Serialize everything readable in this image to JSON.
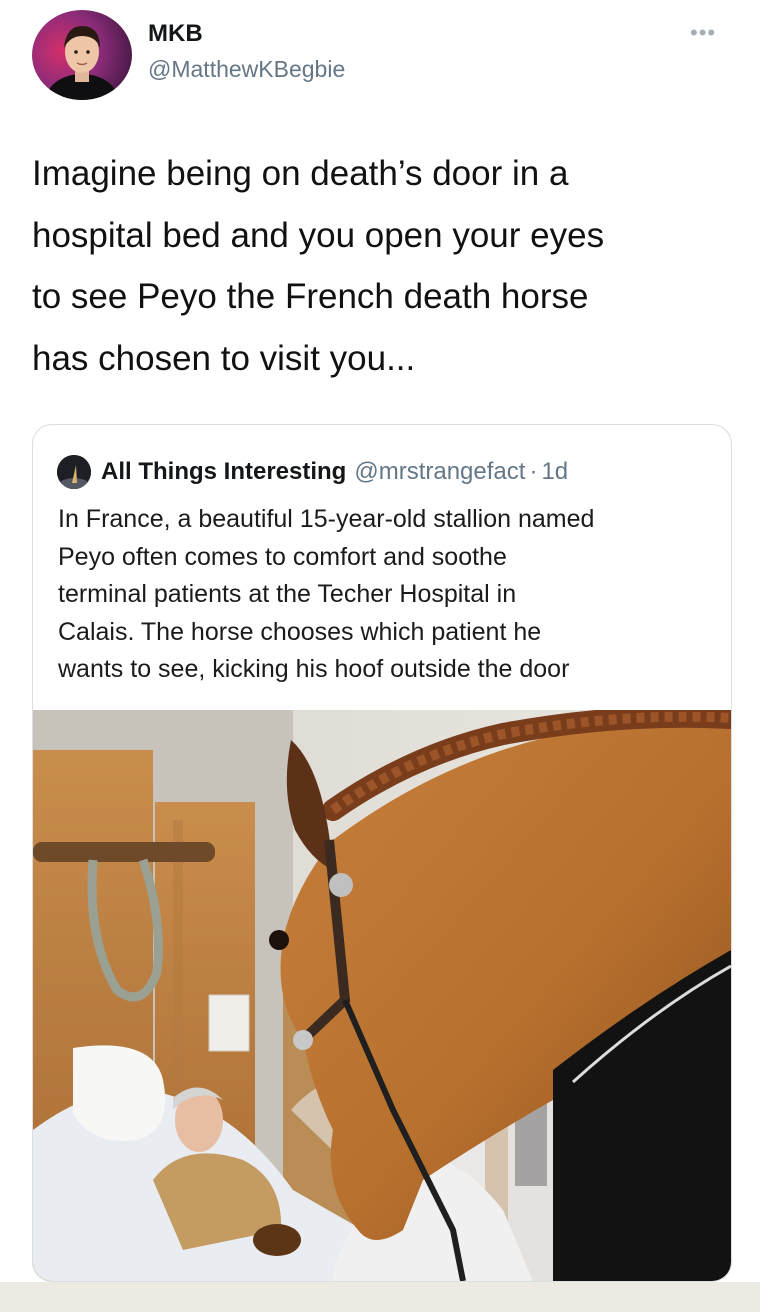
{
  "tweet": {
    "display_name": "MKB",
    "handle": "@MatthewKBegbie",
    "more_icon": "more-horizontal-icon",
    "text": "Imagine being on death’s door in a\nhospital bed and you open your eyes\nto see Peyo the French death horse\nhas chosen to visit you..."
  },
  "quote": {
    "name": "All Things Interesting",
    "handle": "@mrstrangefact",
    "separator": "·",
    "time": "1d",
    "text": "In France, a beautiful 15-year-old stallion named\nPeyo often comes to comfort and soothe\nterminal patients at the Techer Hospital in\nCalais. The horse chooses which patient he\nwants to see, kicking his hoof outside the door"
  },
  "colors": {
    "text": "#14171a",
    "secondary": "#657786",
    "border": "#d9dee2",
    "horse": "#b8702e"
  }
}
